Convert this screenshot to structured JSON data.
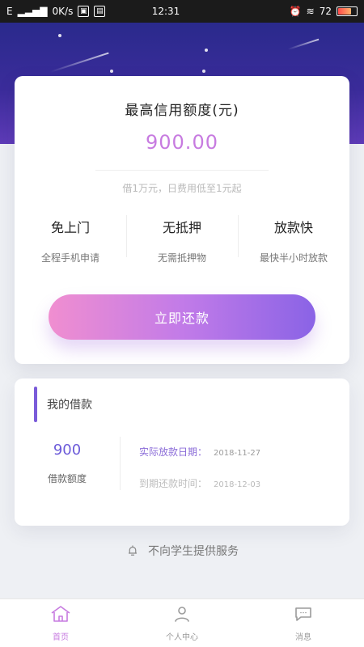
{
  "status_bar": {
    "carrier": "E",
    "net_speed": "0K/s",
    "time": "12:31",
    "battery": "72"
  },
  "credit": {
    "label": "最高信用额度(元)",
    "amount": "900.00",
    "note": "借1万元，日费用低至1元起"
  },
  "features": [
    {
      "title": "免上门",
      "desc": "全程手机申请"
    },
    {
      "title": "无抵押",
      "desc": "无需抵押物"
    },
    {
      "title": "放款快",
      "desc": "最快半小时放款"
    }
  ],
  "cta": {
    "label": "立即还款"
  },
  "my_loan": {
    "title": "我的借款",
    "amount": "900",
    "amount_label": "借款额度",
    "actual_date_label": "实际放款日期：",
    "actual_date": "2018-11-27",
    "due_date_label": "到期还款时间：",
    "due_date": "2018-12-03"
  },
  "notice": {
    "text": "不向学生提供服务"
  },
  "bottom_nav": [
    {
      "label": "首页",
      "icon": "home-icon",
      "active": true
    },
    {
      "label": "个人中心",
      "icon": "user-icon",
      "active": false
    },
    {
      "label": "消息",
      "icon": "message-icon",
      "active": false
    }
  ],
  "colors": {
    "accent": "#c77be0",
    "accent_purple": "#7a5bd9",
    "hero_top": "#2a2a8c",
    "hero_bottom": "#5e3bb8"
  }
}
